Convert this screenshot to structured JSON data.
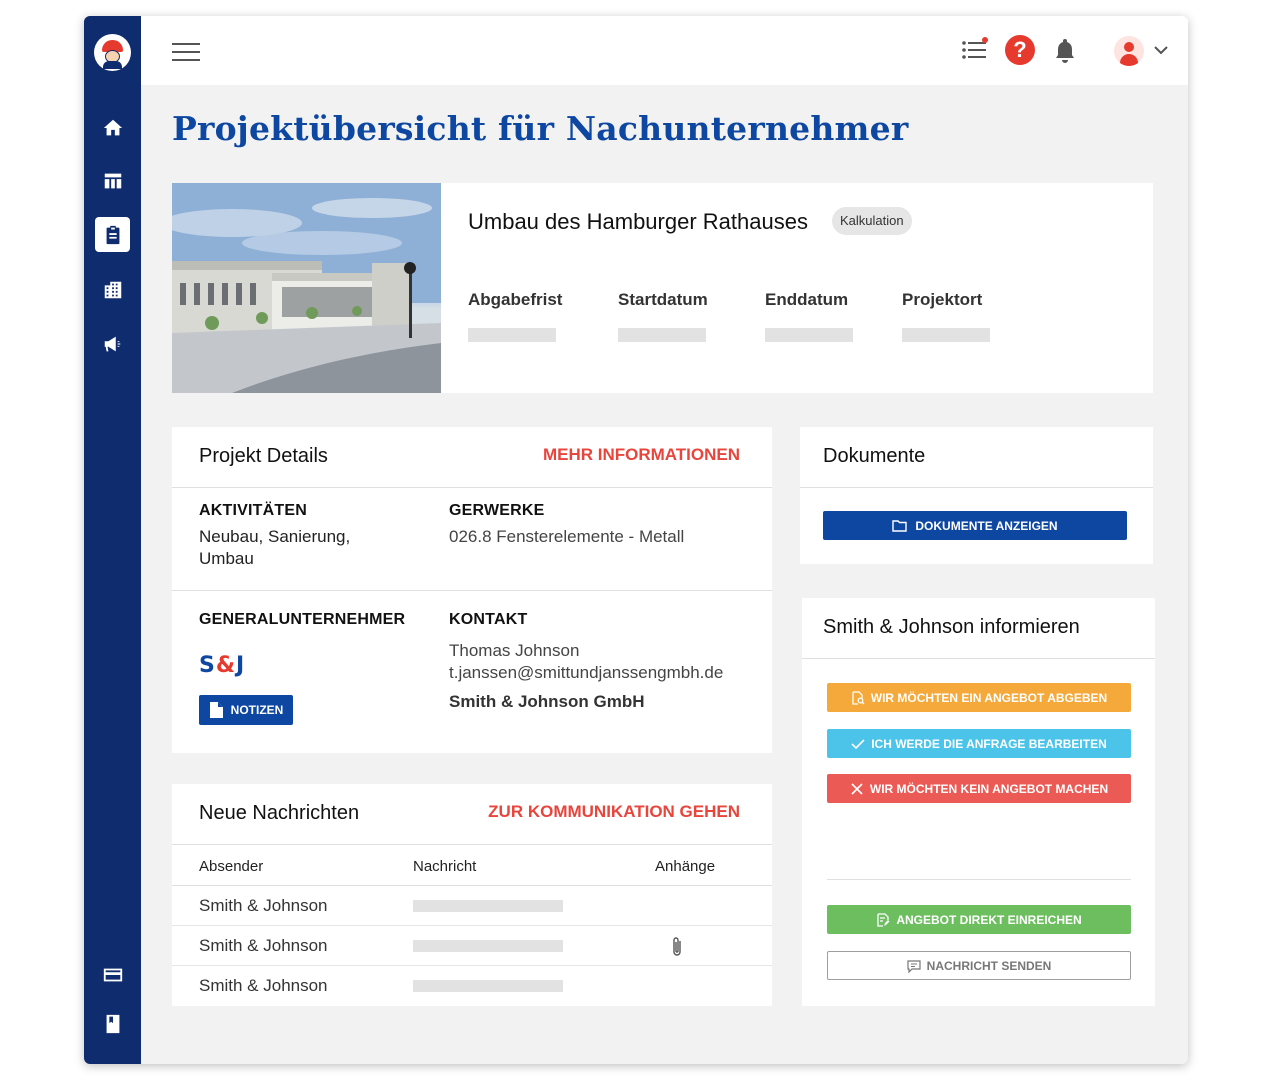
{
  "page": {
    "title": "Projektübersicht für Nachunternehmer"
  },
  "project": {
    "name": "Umbau des Hamburger Rathauses",
    "status": "Kalkulation",
    "meta": [
      {
        "label": "Abgabefrist"
      },
      {
        "label": "Startdatum"
      },
      {
        "label": "Enddatum"
      },
      {
        "label": "Projektort"
      }
    ]
  },
  "details": {
    "title": "Projekt Details",
    "link": "MEHR INFORMATIONEN",
    "activities_label": "AKTIVITÄTEN",
    "activities_value": "Neubau, Sanierung, Umbau",
    "trades_label": "GERWERKE",
    "trades_value": "026.8 Fensterelemente - Metall",
    "gc_label": "GENERALUNTERNEHMER",
    "gc_logo_left": "S",
    "gc_logo_amp": "&",
    "gc_logo_right": "J",
    "notes_button": "NOTIZEN",
    "contact_label": "KONTAKT",
    "contact_name": "Thomas Johnson",
    "contact_email": "t.janssen@smittundjanssengmbh.de",
    "contact_company": "Smith & Johnson GmbH"
  },
  "messages": {
    "title": "Neue Nachrichten",
    "link": "ZUR KOMMUNIKATION GEHEN",
    "columns": [
      "Absender",
      "Nachricht",
      "Anhänge"
    ],
    "rows": [
      {
        "sender": "Smith & Johnson",
        "attachment": false
      },
      {
        "sender": "Smith & Johnson",
        "attachment": true
      },
      {
        "sender": "Smith & Johnson",
        "attachment": false
      }
    ]
  },
  "documents": {
    "title": "Dokumente",
    "button": "DOKUMENTE ANZEIGEN"
  },
  "inform": {
    "title": "Smith & Johnson informieren",
    "offer_button": "WIR MÖCHTEN EIN ANGEBOT ABGEBEN",
    "process_button": "ICH WERDE DIE ANFRAGE BEARBEITEN",
    "decline_button": "WIR MÖCHTEN KEIN ANGEBOT MACHEN",
    "submit_button": "ANGEBOT DIREKT EINREICHEN",
    "message_button": "NACHRICHT SENDEN"
  },
  "colors": {
    "sidebar": "#0f2c6e",
    "primary": "#0d47a1",
    "accent_red": "#e8453c",
    "orange": "#f4a93a",
    "cyan": "#4cc3e8",
    "red": "#ec5a55",
    "green": "#6cbe5f"
  },
  "icons": {
    "sidebar": [
      "home-icon",
      "table-icon",
      "clipboard-icon",
      "building-icon",
      "megaphone-icon",
      "credit-card-icon",
      "book-icon"
    ],
    "topbar": [
      "menu-icon",
      "task-list-icon",
      "help-icon",
      "bell-icon",
      "user-avatar-icon",
      "chevron-down-icon"
    ]
  }
}
